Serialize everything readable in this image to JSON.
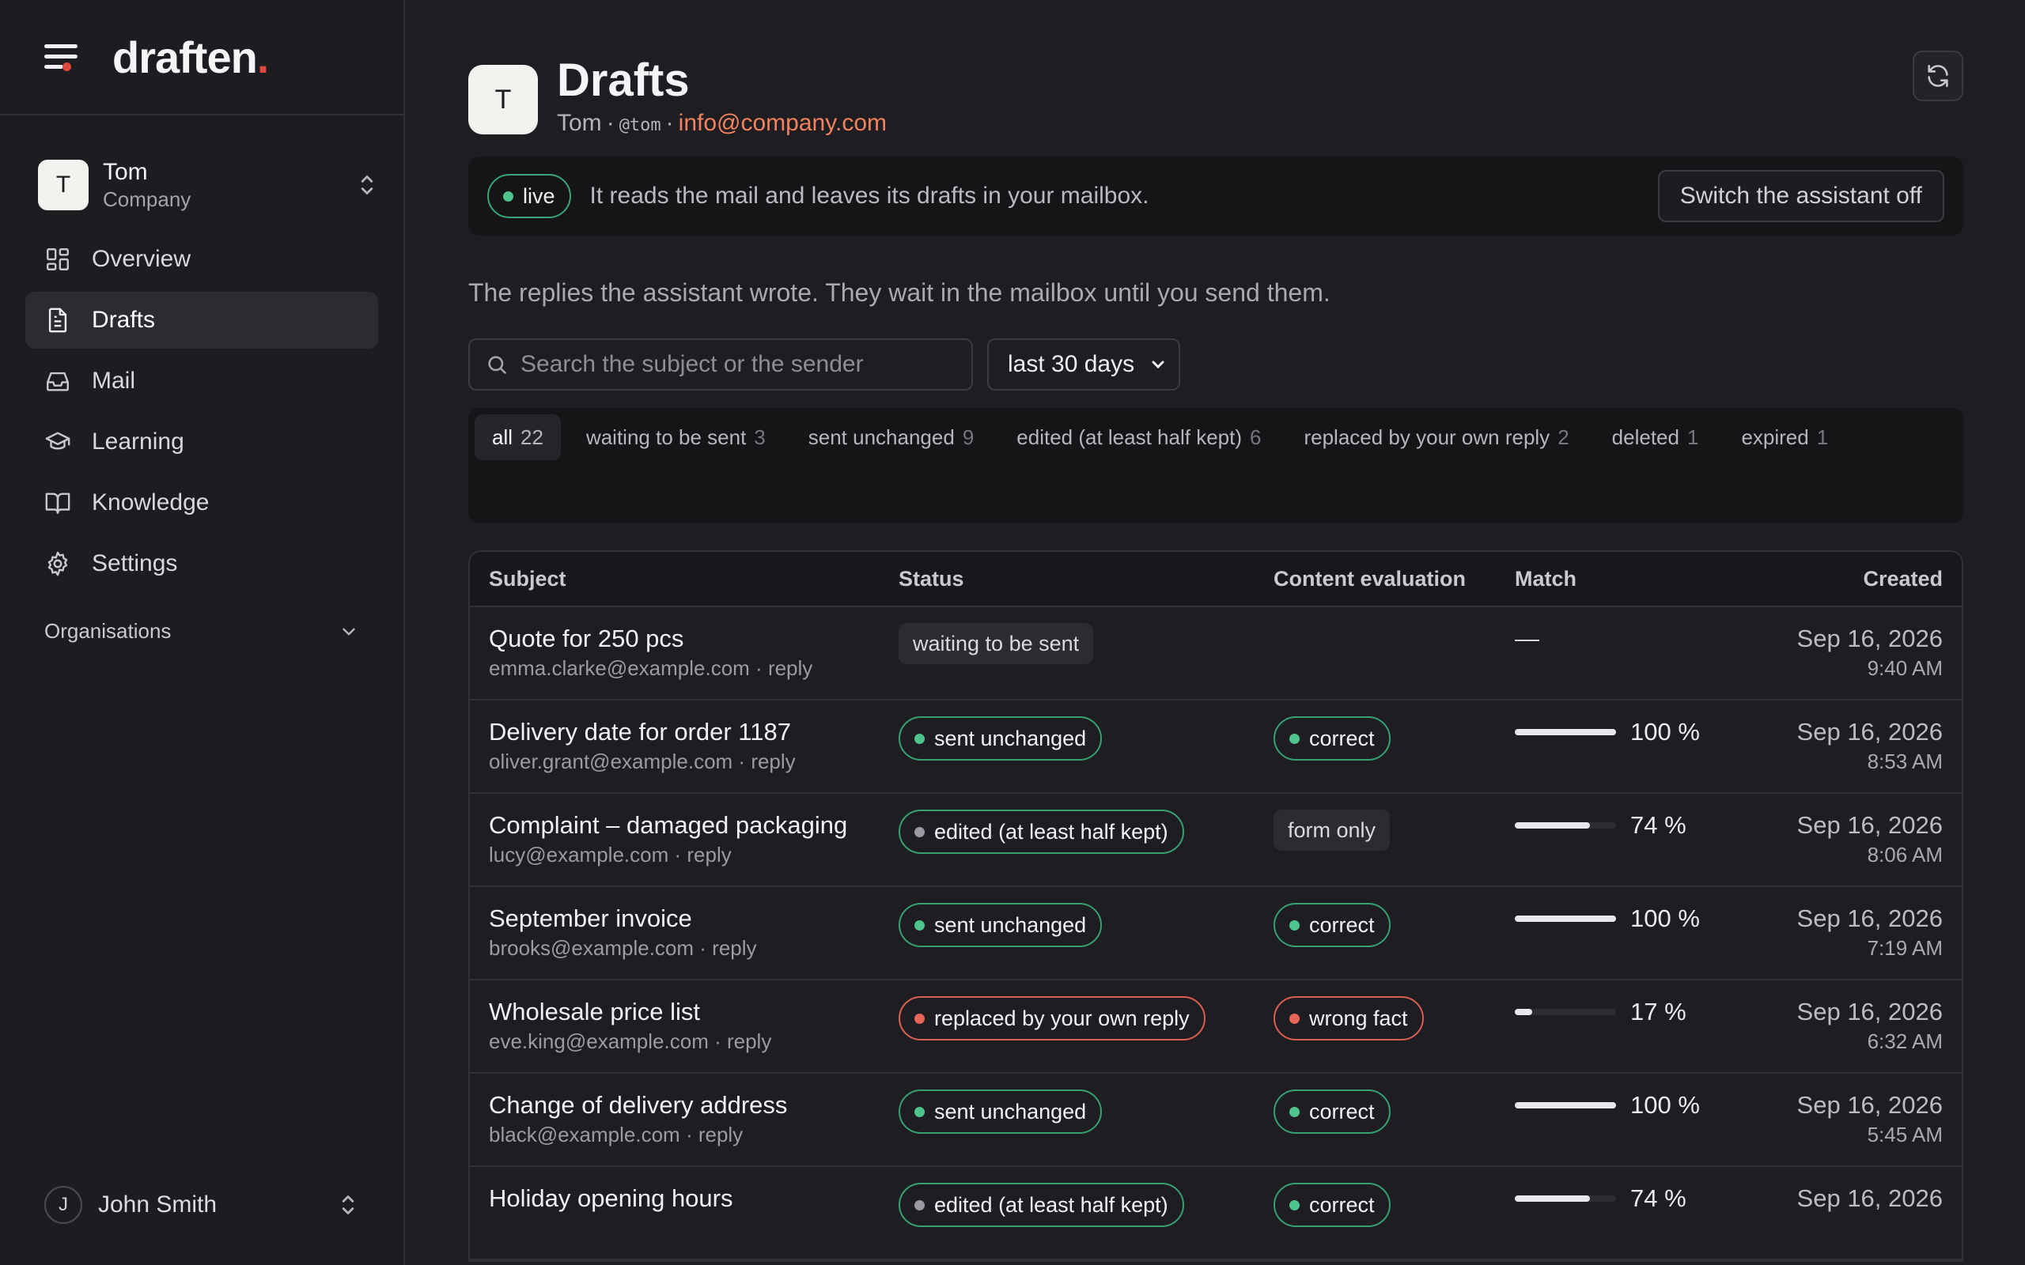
{
  "brand": {
    "logo_text": "draften",
    "logo_dot": "."
  },
  "org_switcher": {
    "initial": "T",
    "name": "Tom",
    "subtitle": "Company"
  },
  "nav": [
    {
      "label": "Overview",
      "icon": "grid-icon",
      "active": false
    },
    {
      "label": "Drafts",
      "icon": "document-icon",
      "active": true
    },
    {
      "label": "Mail",
      "icon": "inbox-icon",
      "active": false
    },
    {
      "label": "Learning",
      "icon": "graduation-cap-icon",
      "active": false
    },
    {
      "label": "Knowledge",
      "icon": "book-icon",
      "active": false
    },
    {
      "label": "Settings",
      "icon": "gear-icon",
      "active": false
    }
  ],
  "organisations": {
    "label": "Organisations"
  },
  "user": {
    "initial": "J",
    "name": "John Smith"
  },
  "header": {
    "initial": "T",
    "title": "Drafts",
    "name": "Tom",
    "separator": "·",
    "handle": "@tom",
    "email": "info@company.com"
  },
  "banner": {
    "status": "live",
    "text": "It reads the mail and leaves its drafts in your mailbox.",
    "button": "Switch the assistant off"
  },
  "intro": "The replies the assistant wrote. They wait in the mailbox until you send them.",
  "search": {
    "placeholder": "Search the subject or the sender"
  },
  "range": {
    "selected": "last 30 days"
  },
  "tabs": [
    {
      "label": "all",
      "count": "22"
    },
    {
      "label": "waiting to be sent",
      "count": "3"
    },
    {
      "label": "sent unchanged",
      "count": "9"
    },
    {
      "label": "edited (at least half kept)",
      "count": "6"
    },
    {
      "label": "replaced by your own reply",
      "count": "2"
    },
    {
      "label": "deleted",
      "count": "1"
    },
    {
      "label": "expired",
      "count": "1"
    }
  ],
  "table": {
    "columns": {
      "subject": "Subject",
      "status": "Status",
      "eval": "Content evaluation",
      "match": "Match",
      "created": "Created"
    },
    "rows": [
      {
        "subject": "Quote for 250 pcs",
        "sender": "emma.clarke@example.com",
        "kind": "reply",
        "status": "waiting to be sent",
        "status_tone": "neutral",
        "eval": "",
        "eval_tone": "",
        "match": "—",
        "match_pct": null,
        "date": "Sep 16, 2026",
        "time": "9:40 AM"
      },
      {
        "subject": "Delivery date for order 1187",
        "sender": "oliver.grant@example.com",
        "kind": "reply",
        "status": "sent unchanged",
        "status_tone": "green",
        "eval": "correct",
        "eval_tone": "green",
        "match": "100 %",
        "match_pct": 100,
        "date": "Sep 16, 2026",
        "time": "8:53 AM"
      },
      {
        "subject": "Complaint – damaged packaging",
        "sender": "lucy@example.com",
        "kind": "reply",
        "status": "edited (at least half kept)",
        "status_tone": "green-gray",
        "eval": "form only",
        "eval_tone": "neutral",
        "match": "74 %",
        "match_pct": 74,
        "date": "Sep 16, 2026",
        "time": "8:06 AM"
      },
      {
        "subject": "September invoice",
        "sender": "brooks@example.com",
        "kind": "reply",
        "status": "sent unchanged",
        "status_tone": "green",
        "eval": "correct",
        "eval_tone": "green",
        "match": "100 %",
        "match_pct": 100,
        "date": "Sep 16, 2026",
        "time": "7:19 AM"
      },
      {
        "subject": "Wholesale price list",
        "sender": "eve.king@example.com",
        "kind": "reply",
        "status": "replaced by your own reply",
        "status_tone": "red",
        "eval": "wrong fact",
        "eval_tone": "red",
        "match": "17 %",
        "match_pct": 17,
        "date": "Sep 16, 2026",
        "time": "6:32 AM"
      },
      {
        "subject": "Change of delivery address",
        "sender": "black@example.com",
        "kind": "reply",
        "status": "sent unchanged",
        "status_tone": "green",
        "eval": "correct",
        "eval_tone": "green",
        "match": "100 %",
        "match_pct": 100,
        "date": "Sep 16, 2026",
        "time": "5:45 AM"
      },
      {
        "subject": "Holiday opening hours",
        "sender": "",
        "kind": "",
        "status": "edited (at least half kept)",
        "status_tone": "green-gray",
        "eval": "correct",
        "eval_tone": "green",
        "match": "74 %",
        "match_pct": 74,
        "date": "Sep 16, 2026",
        "time": ""
      }
    ]
  },
  "colors": {
    "accent_orange": "#f2825e",
    "brand_red": "#e0483d",
    "status_green": "#4ec38c",
    "status_red": "#e8655a"
  }
}
